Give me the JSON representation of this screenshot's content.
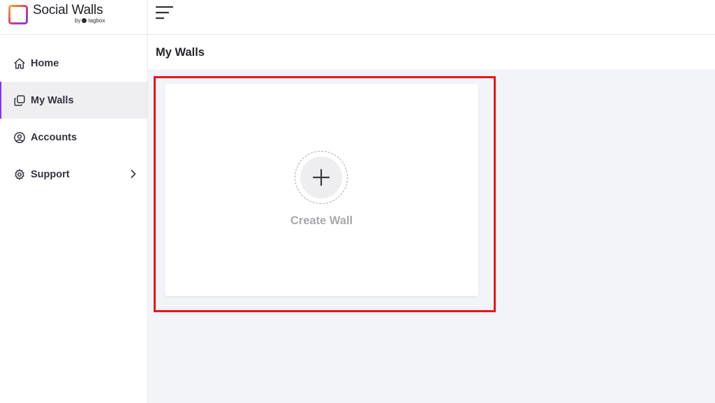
{
  "brand": {
    "name": "Social Walls",
    "by": "by",
    "company": "tagbox",
    "logo_colors": [
      "#f5a623",
      "#e23a7a",
      "#7b3fe4"
    ]
  },
  "sidebar": {
    "items": [
      {
        "label": "Home",
        "icon": "home-icon"
      },
      {
        "label": "My Walls",
        "icon": "walls-icon",
        "active": true
      },
      {
        "label": "Accounts",
        "icon": "account-icon"
      },
      {
        "label": "Support",
        "icon": "gear-icon",
        "has_submenu": true
      }
    ]
  },
  "topbar": {
    "menu_icon": "hamburger-icon"
  },
  "main": {
    "title": "My Walls",
    "create_card": {
      "label": "Create Wall",
      "icon": "plus-icon"
    }
  },
  "colors": {
    "accent": "#7b3fe4",
    "highlight": "#e8141c",
    "content_bg": "#f2f4f7"
  }
}
